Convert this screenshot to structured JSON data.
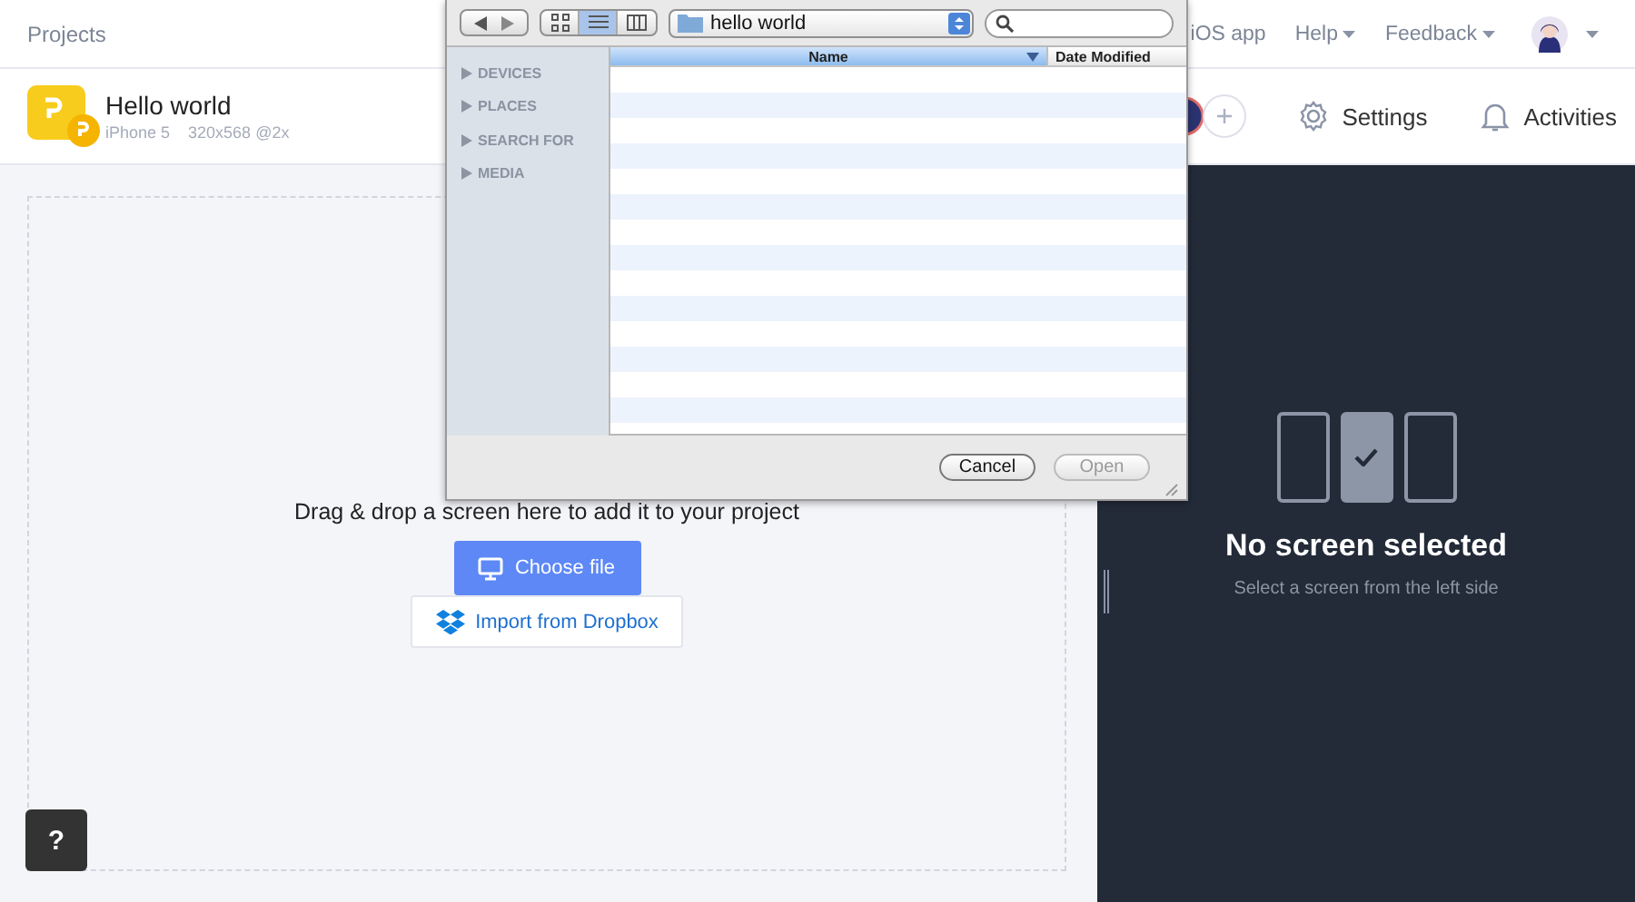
{
  "top_nav": {
    "projects_link": "Projects",
    "links": [
      {
        "label": "iOS app",
        "dropdown": false
      },
      {
        "label": "Help",
        "dropdown": true
      },
      {
        "label": "Feedback",
        "dropdown": true
      }
    ],
    "account_dropdown": true
  },
  "project": {
    "name": "Hello world",
    "device": "iPhone 5",
    "resolution": "320x568 @2x"
  },
  "toolbar": {
    "settings": "Settings",
    "activities": "Activities"
  },
  "drop_area": {
    "instruction": "Drag & drop a screen here to add it to your project",
    "choose_button": "Choose file",
    "dropbox_button": "Import from Dropbox"
  },
  "preview": {
    "screens": [
      {
        "selected": false
      },
      {
        "selected": true
      },
      {
        "selected": false
      }
    ],
    "title": "No screen selected",
    "subtitle": "Select a screen from the left side"
  },
  "help_button": "?",
  "file_dialog": {
    "view_modes": [
      {
        "kind": "icon",
        "selected": false
      },
      {
        "kind": "list",
        "selected": true
      },
      {
        "kind": "column",
        "selected": false
      }
    ],
    "location": "hello world",
    "sidebar": [
      {
        "label": "DEVICES"
      },
      {
        "label": "PLACES"
      },
      {
        "label": "SEARCH FOR"
      },
      {
        "label": "MEDIA"
      }
    ],
    "columns": [
      {
        "label": "Name",
        "sorted": true
      },
      {
        "label": "Date Modified",
        "sorted": false
      }
    ],
    "buttons": [
      {
        "label": "Cancel",
        "disabled": false
      },
      {
        "label": "Open",
        "disabled": true
      }
    ]
  }
}
